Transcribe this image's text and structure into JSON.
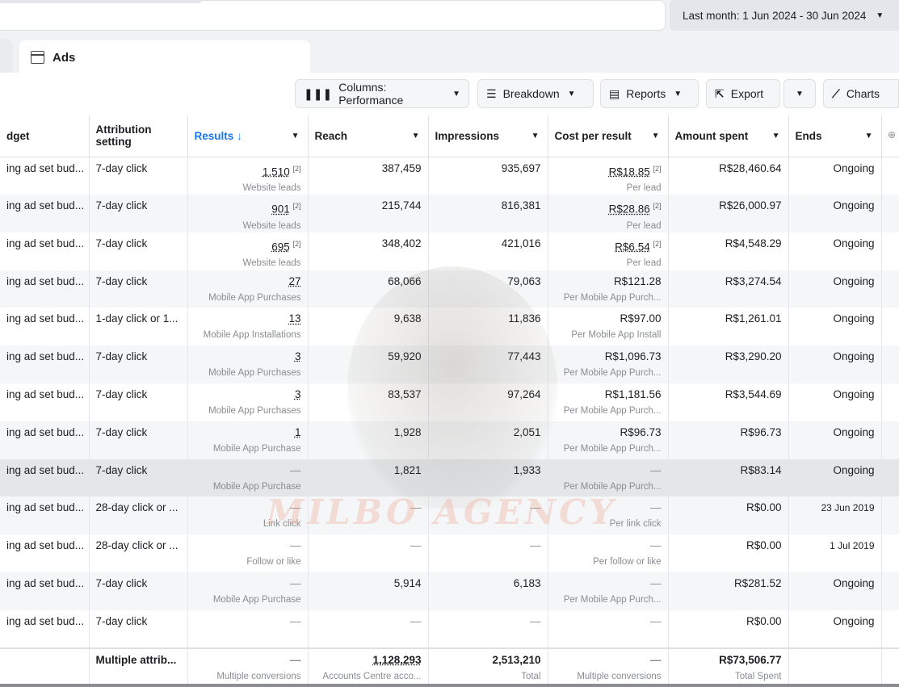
{
  "date_range": {
    "label": "Last month: 1 Jun 2024 - 30 Jun 2024"
  },
  "tabs": {
    "ads": "Ads"
  },
  "toolbar": {
    "columns": "Columns: Performance",
    "breakdown": "Breakdown",
    "reports": "Reports",
    "export": "Export",
    "charts": "Charts"
  },
  "columns": {
    "budget": "dget",
    "attribution": "Attribution setting",
    "results": "Results ↓",
    "reach": "Reach",
    "impressions": "Impressions",
    "cost_per_result": "Cost per result",
    "amount_spent": "Amount spent",
    "ends": "Ends"
  },
  "rows": [
    {
      "budget": "ing ad set bud...",
      "attribution": "7-day click",
      "results": "1,510",
      "results_sup": "[2]",
      "results_sub": "Website leads",
      "reach": "387,459",
      "impressions": "935,697",
      "cpr": "R$18.85",
      "cpr_sup": "[2]",
      "cpr_sub": "Per lead",
      "spent": "R$28,460.64",
      "ends": "Ongoing"
    },
    {
      "budget": "ing ad set bud...",
      "attribution": "7-day click",
      "results": "901",
      "results_sup": "[2]",
      "results_sub": "Website leads",
      "reach": "215,744",
      "impressions": "816,381",
      "cpr": "R$28.86",
      "cpr_sup": "[2]",
      "cpr_sub": "Per lead",
      "spent": "R$26,000.97",
      "ends": "Ongoing"
    },
    {
      "budget": "ing ad set bud...",
      "attribution": "7-day click",
      "results": "695",
      "results_sup": "[2]",
      "results_sub": "Website leads",
      "reach": "348,402",
      "impressions": "421,016",
      "cpr": "R$6.54",
      "cpr_sup": "[2]",
      "cpr_sub": "Per lead",
      "spent": "R$4,548.29",
      "ends": "Ongoing"
    },
    {
      "budget": "ing ad set bud...",
      "attribution": "7-day click",
      "results": "27",
      "results_sup": "",
      "results_sub": "Mobile App Purchases",
      "reach": "68,066",
      "impressions": "79,063",
      "cpr": "R$121.28",
      "cpr_sup": "",
      "cpr_sub": "Per Mobile App Purch...",
      "spent": "R$3,274.54",
      "ends": "Ongoing"
    },
    {
      "budget": "ing ad set bud...",
      "attribution": "1-day click or 1...",
      "results": "13",
      "results_sup": "",
      "results_sub": "Mobile App Installations",
      "reach": "9,638",
      "impressions": "11,836",
      "cpr": "R$97.00",
      "cpr_sup": "",
      "cpr_sub": "Per Mobile App Install",
      "spent": "R$1,261.01",
      "ends": "Ongoing"
    },
    {
      "budget": "ing ad set bud...",
      "attribution": "7-day click",
      "results": "3",
      "results_sup": "",
      "results_sub": "Mobile App Purchases",
      "reach": "59,920",
      "impressions": "77,443",
      "cpr": "R$1,096.73",
      "cpr_sup": "",
      "cpr_sub": "Per Mobile App Purch...",
      "spent": "R$3,290.20",
      "ends": "Ongoing"
    },
    {
      "budget": "ing ad set bud...",
      "attribution": "7-day click",
      "results": "3",
      "results_sup": "",
      "results_sub": "Mobile App Purchases",
      "reach": "83,537",
      "impressions": "97,264",
      "cpr": "R$1,181.56",
      "cpr_sup": "",
      "cpr_sub": "Per Mobile App Purch...",
      "spent": "R$3,544.69",
      "ends": "Ongoing"
    },
    {
      "budget": "ing ad set bud...",
      "attribution": "7-day click",
      "results": "1",
      "results_sup": "",
      "results_sub": "Mobile App Purchase",
      "reach": "1,928",
      "impressions": "2,051",
      "cpr": "R$96.73",
      "cpr_sup": "",
      "cpr_sub": "Per Mobile App Purch...",
      "spent": "R$96.73",
      "ends": "Ongoing"
    },
    {
      "budget": "ing ad set bud...",
      "attribution": "7-day click",
      "results": "—",
      "results_sup": "",
      "results_sub": "Mobile App Purchase",
      "reach": "1,821",
      "impressions": "1,933",
      "cpr": "—",
      "cpr_sup": "",
      "cpr_sub": "Per Mobile App Purch...",
      "spent": "R$83.14",
      "ends": "Ongoing"
    },
    {
      "budget": "ing ad set bud...",
      "attribution": "28-day click or ...",
      "results": "—",
      "results_sup": "",
      "results_sub": "Link click",
      "reach": "—",
      "impressions": "—",
      "cpr": "—",
      "cpr_sup": "",
      "cpr_sub": "Per link click",
      "spent": "R$0.00",
      "ends": "23 Jun 2019"
    },
    {
      "budget": "ing ad set bud...",
      "attribution": "28-day click or ...",
      "results": "—",
      "results_sup": "",
      "results_sub": "Follow or like",
      "reach": "—",
      "impressions": "—",
      "cpr": "—",
      "cpr_sup": "",
      "cpr_sub": "Per follow or like",
      "spent": "R$0.00",
      "ends": "1 Jul 2019"
    },
    {
      "budget": "ing ad set bud...",
      "attribution": "7-day click",
      "results": "—",
      "results_sup": "",
      "results_sub": "Mobile App Purchase",
      "reach": "5,914",
      "impressions": "6,183",
      "cpr": "—",
      "cpr_sup": "",
      "cpr_sub": "Per Mobile App Purch...",
      "spent": "R$281.52",
      "ends": "Ongoing"
    },
    {
      "budget": "ing ad set bud...",
      "attribution": "7-day click",
      "results": "—",
      "results_sup": "",
      "results_sub": "",
      "reach": "—",
      "impressions": "—",
      "cpr": "—",
      "cpr_sup": "",
      "cpr_sub": "",
      "spent": "R$0.00",
      "ends": "Ongoing"
    }
  ],
  "totals": {
    "attribution": "Multiple attrib...",
    "results": "—",
    "results_sub": "Multiple conversions",
    "reach": "1,128,293",
    "reach_sub": "Accounts Centre acco...",
    "impressions": "2,513,210",
    "impressions_sub": "Total",
    "cpr": "—",
    "cpr_sub": "Multiple conversions",
    "spent": "R$73,506.77",
    "spent_sub": "Total Spent"
  },
  "watermark": "MILBO AGENCY"
}
